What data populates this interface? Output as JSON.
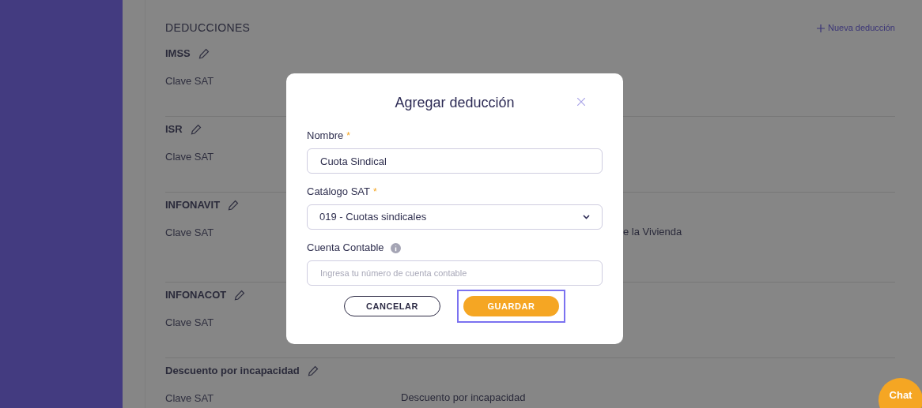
{
  "section": {
    "title": "DEDUCCIONES",
    "add_link": "Nueva deducción"
  },
  "deductions": [
    {
      "name": "IMSS",
      "field_label": "Clave SAT"
    },
    {
      "name": "ISR",
      "field_label": "Clave SAT"
    },
    {
      "name": "INFONAVIT",
      "field_label": "Clave SAT",
      "value": "e la Vivienda",
      "value_partly_hidden": true
    },
    {
      "name": "INFONACOT",
      "field_label": "Clave SAT"
    },
    {
      "name": "Descuento por incapacidad",
      "field_label": "Clave SAT",
      "value": "Descuento por incapacidad"
    }
  ],
  "dialog": {
    "title": "Agregar deducción",
    "fields": [
      {
        "kind": "text",
        "label": "Nombre",
        "required_mark": "*",
        "value": "Cuota Sindical"
      },
      {
        "kind": "select",
        "label": "Catálogo SAT",
        "required_mark": "*",
        "value": "019 - Cuotas sindicales"
      },
      {
        "kind": "text",
        "label": "Cuenta Contable",
        "info": true,
        "placeholder": "Ingresa tu número de cuenta contable"
      }
    ],
    "cancel": "CANCELAR",
    "save": "GUARDAR",
    "save_focused": true
  },
  "chat": "Chat"
}
